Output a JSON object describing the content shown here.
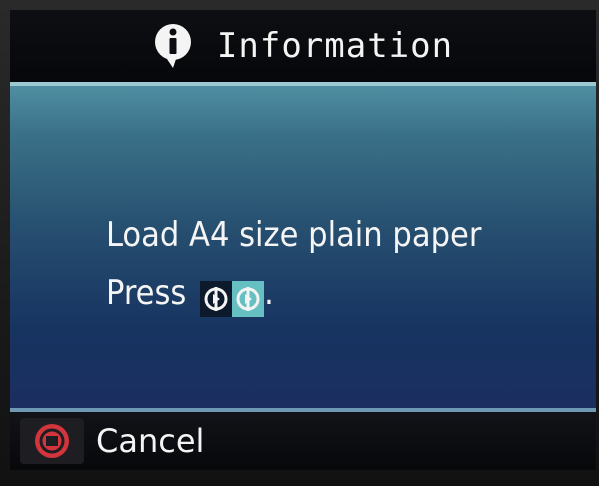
{
  "header": {
    "icon": "info-icon",
    "title": "Information"
  },
  "message": {
    "line1": "Load A4 size plain paper",
    "line2_prefix": "Press",
    "line2_suffix": "."
  },
  "keys": [
    {
      "name": "black-start-icon",
      "color": "#0c1a2b"
    },
    {
      "name": "color-start-icon",
      "color": "#66c0c2"
    }
  ],
  "footer": {
    "icon": "stop-icon",
    "label": "Cancel"
  },
  "colors": {
    "panel_top": "#4f8ea2",
    "panel_bottom": "#1b2e5f",
    "stop_red": "#d2353c"
  }
}
